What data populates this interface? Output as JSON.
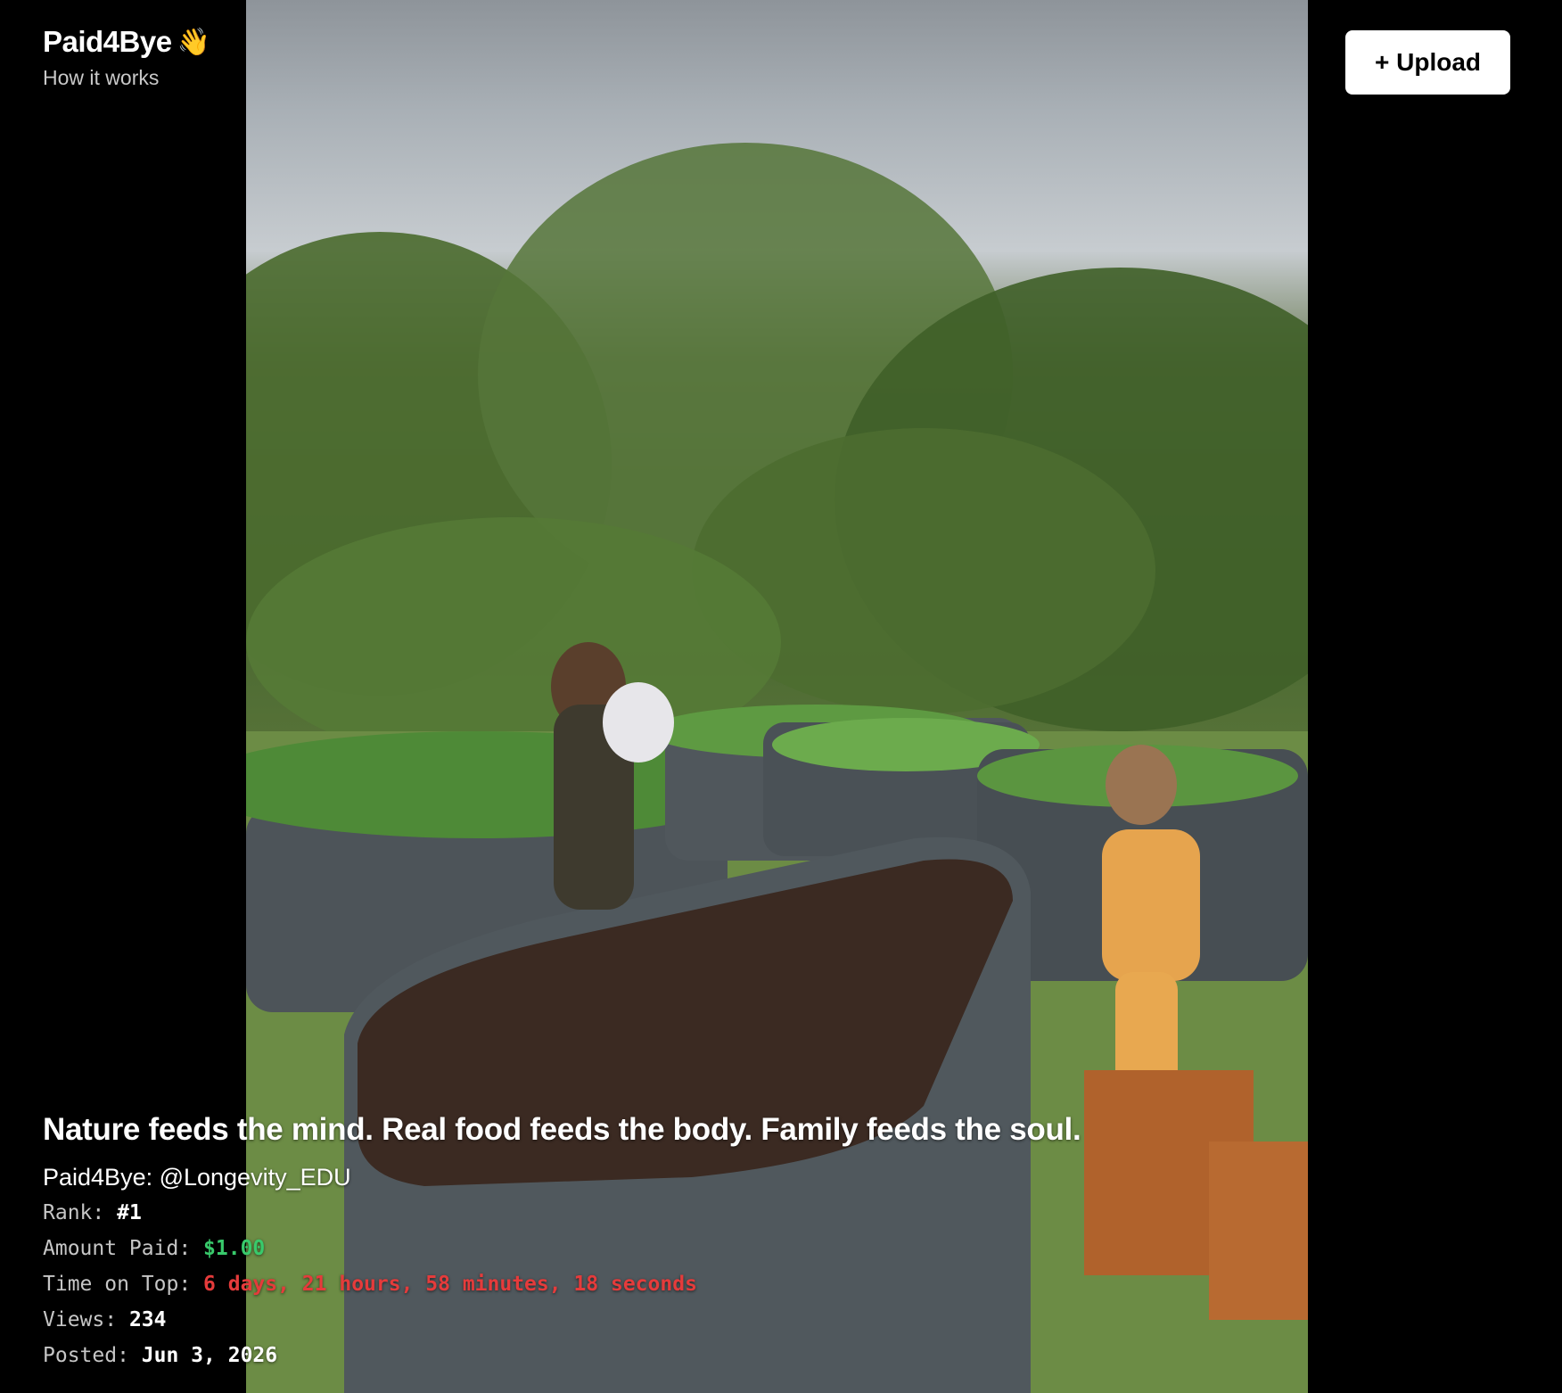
{
  "brand": {
    "title": "Paid4Bye",
    "icon": "waving-hand-icon",
    "emoji": "👋",
    "how_it_works": "How it works"
  },
  "toolbar": {
    "upload_label": "+ Upload"
  },
  "post": {
    "caption": "Nature feeds the mind. Real food feeds the body. Family feeds the soul.",
    "author": "Paid4Bye: @Longevity_EDU",
    "rank_label": "Rank:",
    "rank_value": "#1",
    "amount_label": "Amount Paid:",
    "amount_value": "$1.00",
    "time_label": "Time on Top:",
    "time_value": "6 days, 21 hours, 58 minutes, 18 seconds",
    "views_label": "Views:",
    "views_value": "234",
    "posted_label": "Posted:",
    "posted_value": "Jun 3, 2026"
  },
  "colors": {
    "amount": "#38c96b",
    "time": "#e53b3b",
    "background": "#000000"
  }
}
